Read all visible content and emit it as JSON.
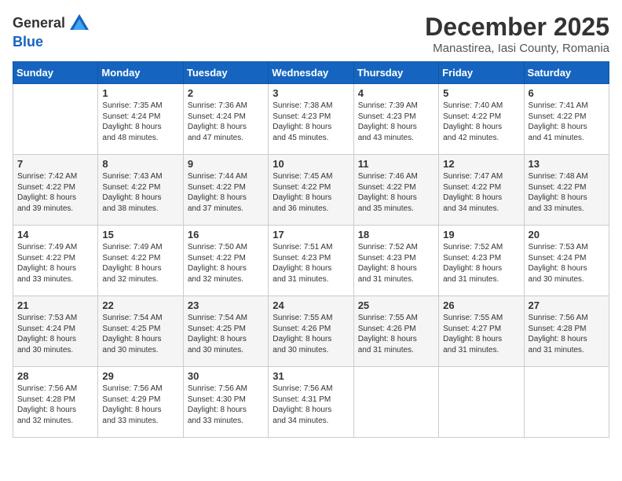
{
  "header": {
    "logo_general": "General",
    "logo_blue": "Blue",
    "month_title": "December 2025",
    "location": "Manastirea, Iasi County, Romania"
  },
  "weekdays": [
    "Sunday",
    "Monday",
    "Tuesday",
    "Wednesday",
    "Thursday",
    "Friday",
    "Saturday"
  ],
  "weeks": [
    [
      {
        "day": "",
        "sunrise": "",
        "sunset": "",
        "daylight": ""
      },
      {
        "day": "1",
        "sunrise": "Sunrise: 7:35 AM",
        "sunset": "Sunset: 4:24 PM",
        "daylight": "Daylight: 8 hours and 48 minutes."
      },
      {
        "day": "2",
        "sunrise": "Sunrise: 7:36 AM",
        "sunset": "Sunset: 4:24 PM",
        "daylight": "Daylight: 8 hours and 47 minutes."
      },
      {
        "day": "3",
        "sunrise": "Sunrise: 7:38 AM",
        "sunset": "Sunset: 4:23 PM",
        "daylight": "Daylight: 8 hours and 45 minutes."
      },
      {
        "day": "4",
        "sunrise": "Sunrise: 7:39 AM",
        "sunset": "Sunset: 4:23 PM",
        "daylight": "Daylight: 8 hours and 43 minutes."
      },
      {
        "day": "5",
        "sunrise": "Sunrise: 7:40 AM",
        "sunset": "Sunset: 4:22 PM",
        "daylight": "Daylight: 8 hours and 42 minutes."
      },
      {
        "day": "6",
        "sunrise": "Sunrise: 7:41 AM",
        "sunset": "Sunset: 4:22 PM",
        "daylight": "Daylight: 8 hours and 41 minutes."
      }
    ],
    [
      {
        "day": "7",
        "sunrise": "Sunrise: 7:42 AM",
        "sunset": "Sunset: 4:22 PM",
        "daylight": "Daylight: 8 hours and 39 minutes."
      },
      {
        "day": "8",
        "sunrise": "Sunrise: 7:43 AM",
        "sunset": "Sunset: 4:22 PM",
        "daylight": "Daylight: 8 hours and 38 minutes."
      },
      {
        "day": "9",
        "sunrise": "Sunrise: 7:44 AM",
        "sunset": "Sunset: 4:22 PM",
        "daylight": "Daylight: 8 hours and 37 minutes."
      },
      {
        "day": "10",
        "sunrise": "Sunrise: 7:45 AM",
        "sunset": "Sunset: 4:22 PM",
        "daylight": "Daylight: 8 hours and 36 minutes."
      },
      {
        "day": "11",
        "sunrise": "Sunrise: 7:46 AM",
        "sunset": "Sunset: 4:22 PM",
        "daylight": "Daylight: 8 hours and 35 minutes."
      },
      {
        "day": "12",
        "sunrise": "Sunrise: 7:47 AM",
        "sunset": "Sunset: 4:22 PM",
        "daylight": "Daylight: 8 hours and 34 minutes."
      },
      {
        "day": "13",
        "sunrise": "Sunrise: 7:48 AM",
        "sunset": "Sunset: 4:22 PM",
        "daylight": "Daylight: 8 hours and 33 minutes."
      }
    ],
    [
      {
        "day": "14",
        "sunrise": "Sunrise: 7:49 AM",
        "sunset": "Sunset: 4:22 PM",
        "daylight": "Daylight: 8 hours and 33 minutes."
      },
      {
        "day": "15",
        "sunrise": "Sunrise: 7:49 AM",
        "sunset": "Sunset: 4:22 PM",
        "daylight": "Daylight: 8 hours and 32 minutes."
      },
      {
        "day": "16",
        "sunrise": "Sunrise: 7:50 AM",
        "sunset": "Sunset: 4:22 PM",
        "daylight": "Daylight: 8 hours and 32 minutes."
      },
      {
        "day": "17",
        "sunrise": "Sunrise: 7:51 AM",
        "sunset": "Sunset: 4:23 PM",
        "daylight": "Daylight: 8 hours and 31 minutes."
      },
      {
        "day": "18",
        "sunrise": "Sunrise: 7:52 AM",
        "sunset": "Sunset: 4:23 PM",
        "daylight": "Daylight: 8 hours and 31 minutes."
      },
      {
        "day": "19",
        "sunrise": "Sunrise: 7:52 AM",
        "sunset": "Sunset: 4:23 PM",
        "daylight": "Daylight: 8 hours and 31 minutes."
      },
      {
        "day": "20",
        "sunrise": "Sunrise: 7:53 AM",
        "sunset": "Sunset: 4:24 PM",
        "daylight": "Daylight: 8 hours and 30 minutes."
      }
    ],
    [
      {
        "day": "21",
        "sunrise": "Sunrise: 7:53 AM",
        "sunset": "Sunset: 4:24 PM",
        "daylight": "Daylight: 8 hours and 30 minutes."
      },
      {
        "day": "22",
        "sunrise": "Sunrise: 7:54 AM",
        "sunset": "Sunset: 4:25 PM",
        "daylight": "Daylight: 8 hours and 30 minutes."
      },
      {
        "day": "23",
        "sunrise": "Sunrise: 7:54 AM",
        "sunset": "Sunset: 4:25 PM",
        "daylight": "Daylight: 8 hours and 30 minutes."
      },
      {
        "day": "24",
        "sunrise": "Sunrise: 7:55 AM",
        "sunset": "Sunset: 4:26 PM",
        "daylight": "Daylight: 8 hours and 30 minutes."
      },
      {
        "day": "25",
        "sunrise": "Sunrise: 7:55 AM",
        "sunset": "Sunset: 4:26 PM",
        "daylight": "Daylight: 8 hours and 31 minutes."
      },
      {
        "day": "26",
        "sunrise": "Sunrise: 7:55 AM",
        "sunset": "Sunset: 4:27 PM",
        "daylight": "Daylight: 8 hours and 31 minutes."
      },
      {
        "day": "27",
        "sunrise": "Sunrise: 7:56 AM",
        "sunset": "Sunset: 4:28 PM",
        "daylight": "Daylight: 8 hours and 31 minutes."
      }
    ],
    [
      {
        "day": "28",
        "sunrise": "Sunrise: 7:56 AM",
        "sunset": "Sunset: 4:28 PM",
        "daylight": "Daylight: 8 hours and 32 minutes."
      },
      {
        "day": "29",
        "sunrise": "Sunrise: 7:56 AM",
        "sunset": "Sunset: 4:29 PM",
        "daylight": "Daylight: 8 hours and 33 minutes."
      },
      {
        "day": "30",
        "sunrise": "Sunrise: 7:56 AM",
        "sunset": "Sunset: 4:30 PM",
        "daylight": "Daylight: 8 hours and 33 minutes."
      },
      {
        "day": "31",
        "sunrise": "Sunrise: 7:56 AM",
        "sunset": "Sunset: 4:31 PM",
        "daylight": "Daylight: 8 hours and 34 minutes."
      },
      {
        "day": "",
        "sunrise": "",
        "sunset": "",
        "daylight": ""
      },
      {
        "day": "",
        "sunrise": "",
        "sunset": "",
        "daylight": ""
      },
      {
        "day": "",
        "sunrise": "",
        "sunset": "",
        "daylight": ""
      }
    ]
  ]
}
